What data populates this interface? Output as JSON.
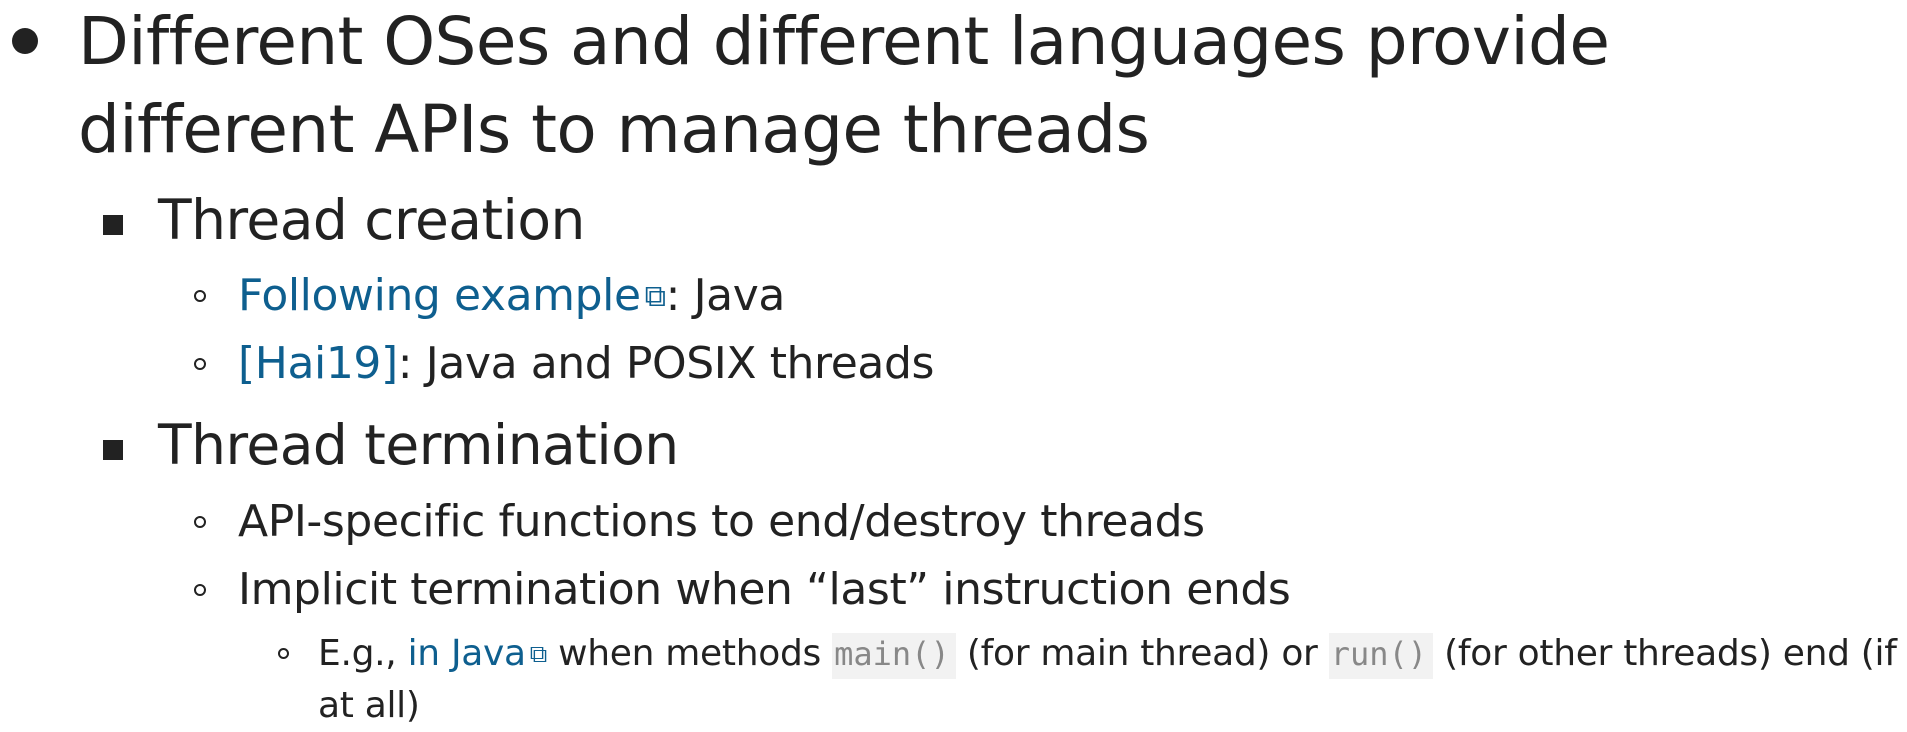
{
  "main_point": {
    "text": "Different OSes and different languages provide different APIs to manage threads"
  },
  "thread_creation": {
    "heading": "Thread creation",
    "items": [
      {
        "link_text": "Following example",
        "rest": ": Java"
      },
      {
        "link_text": "[Hai19]",
        "rest": ": Java and POSIX threads"
      }
    ]
  },
  "thread_termination": {
    "heading": "Thread termination",
    "items": [
      {
        "text": "API-specific functions to end/destroy threads"
      },
      {
        "text": "Implicit termination when “last” instruction ends"
      }
    ],
    "sub_item": {
      "prefix": "E.g., ",
      "link_text": "in Java",
      "mid1": " when methods ",
      "code1": "main()",
      "mid2": " (for main thread) or ",
      "code2": "run()",
      "suffix": " (for other threads) end (if at all)"
    }
  },
  "icons": {
    "external_link": "external-link-icon"
  }
}
